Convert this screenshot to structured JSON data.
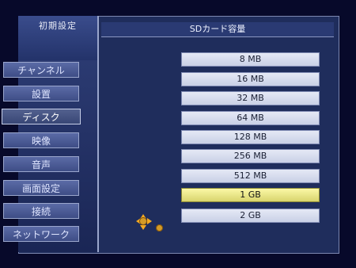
{
  "sidebar": {
    "title": "初期設定",
    "items": [
      {
        "label": "チャンネル"
      },
      {
        "label": "設置"
      },
      {
        "label": "ディスク"
      },
      {
        "label": "映像"
      },
      {
        "label": "音声"
      },
      {
        "label": "画面設定"
      },
      {
        "label": "接続"
      },
      {
        "label": "ネットワーク"
      }
    ],
    "active_index": 2
  },
  "content": {
    "title": "SDカード容量",
    "options": [
      {
        "label": "8 MB"
      },
      {
        "label": "16 MB"
      },
      {
        "label": "32 MB"
      },
      {
        "label": "64 MB"
      },
      {
        "label": "128 MB"
      },
      {
        "label": "256 MB"
      },
      {
        "label": "512 MB"
      },
      {
        "label": "1 GB"
      },
      {
        "label": "2 GB"
      }
    ],
    "selected_index": 7
  },
  "icons": {
    "navigation": "dpad-icon",
    "confirm": "confirm-dot-icon"
  },
  "colors": {
    "background": "#07092a",
    "panel": "#1f2d5c",
    "selected": "#d8d46d",
    "accent": "#f3a922"
  }
}
